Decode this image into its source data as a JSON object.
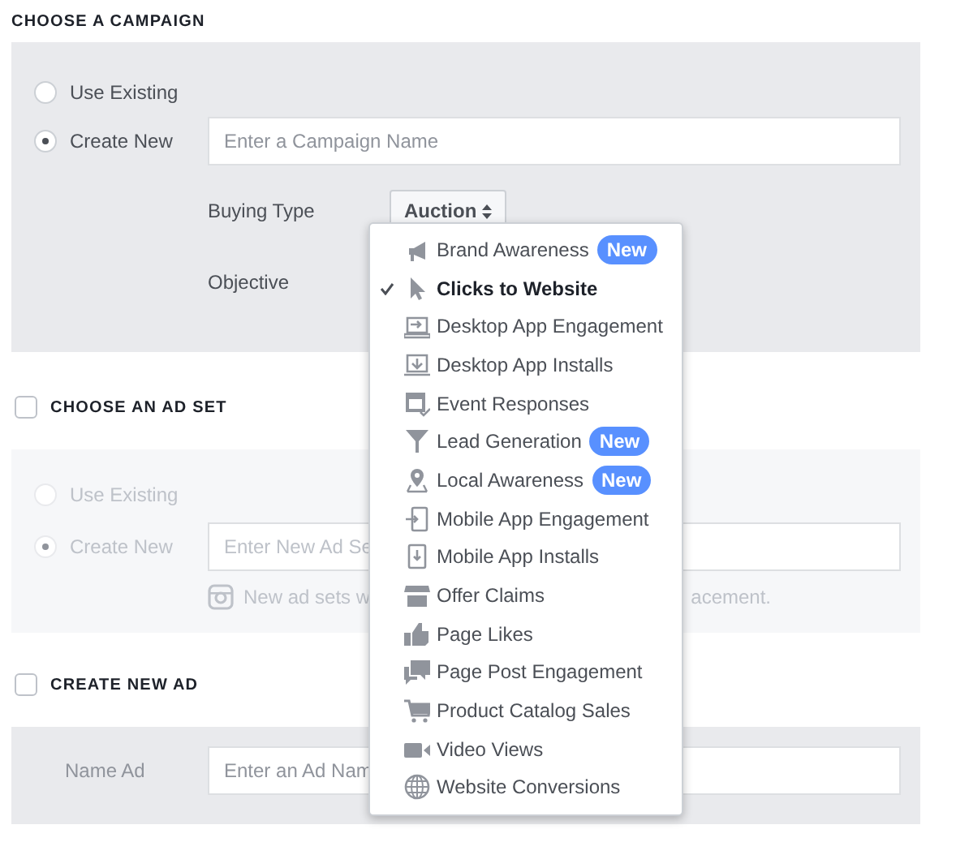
{
  "campaign": {
    "heading": "CHOOSE A CAMPAIGN",
    "options": [
      {
        "label": "Use Existing",
        "selected": false
      },
      {
        "label": "Create New",
        "selected": true
      }
    ],
    "name_field": {
      "placeholder": "Enter a Campaign Name"
    },
    "buying_type": {
      "label": "Buying Type",
      "value": "Auction"
    },
    "objective": {
      "label": "Objective"
    }
  },
  "ad_set": {
    "heading": "CHOOSE AN AD SET",
    "checked": false,
    "disabled": true,
    "options": [
      {
        "label": "Use Existing",
        "selected": false
      },
      {
        "label": "Create New",
        "selected": true
      }
    ],
    "name_field": {
      "placeholder": "Enter New Ad Se"
    },
    "note_parts": [
      "New ad sets w",
      "acement."
    ]
  },
  "new_ad": {
    "heading": "CREATE NEW AD",
    "checked": false,
    "name_label": "Name Ad",
    "name_field": {
      "placeholder": "Enter an Ad Nam"
    }
  },
  "objective_menu": {
    "items": [
      {
        "label": "Brand Awareness",
        "selected": false,
        "badge": "New"
      },
      {
        "label": "Clicks to Website",
        "selected": true
      },
      {
        "label": "Desktop App Engagement",
        "selected": false
      },
      {
        "label": "Desktop App Installs",
        "selected": false
      },
      {
        "label": "Event Responses",
        "selected": false
      },
      {
        "label": "Lead Generation",
        "selected": false,
        "badge": "New"
      },
      {
        "label": "Local Awareness",
        "selected": false,
        "badge": "New"
      },
      {
        "label": "Mobile App Engagement",
        "selected": false
      },
      {
        "label": "Mobile App Installs",
        "selected": false
      },
      {
        "label": "Offer Claims",
        "selected": false
      },
      {
        "label": "Page Likes",
        "selected": false
      },
      {
        "label": "Page Post Engagement",
        "selected": false
      },
      {
        "label": "Product Catalog Sales",
        "selected": false
      },
      {
        "label": "Video Views",
        "selected": false
      },
      {
        "label": "Website Conversions",
        "selected": false
      }
    ]
  }
}
